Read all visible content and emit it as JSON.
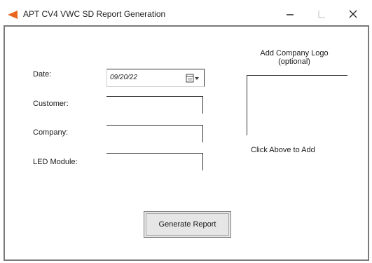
{
  "window": {
    "title": "APT CV4 VWC SD Report Generation",
    "icon": "app-arrow-icon",
    "accent_color": "#e9641e",
    "controls": {
      "minimize_icon": "minimize-icon",
      "maximize_icon": "maximize-icon",
      "close_icon": "close-icon"
    }
  },
  "form": {
    "date_label": "Date:",
    "date_value": "09/20/22",
    "calendar_icon": "calendar-dropdown-icon",
    "customer_label": "Customer:",
    "customer_value": "",
    "company_label": "Company:",
    "company_value": "",
    "led_module_label": "LED Module:",
    "led_module_value": ""
  },
  "logo": {
    "title": "Add Company Logo\n(optional)",
    "hint": "Click Above to Add"
  },
  "actions": {
    "generate_label": "Generate Report"
  }
}
